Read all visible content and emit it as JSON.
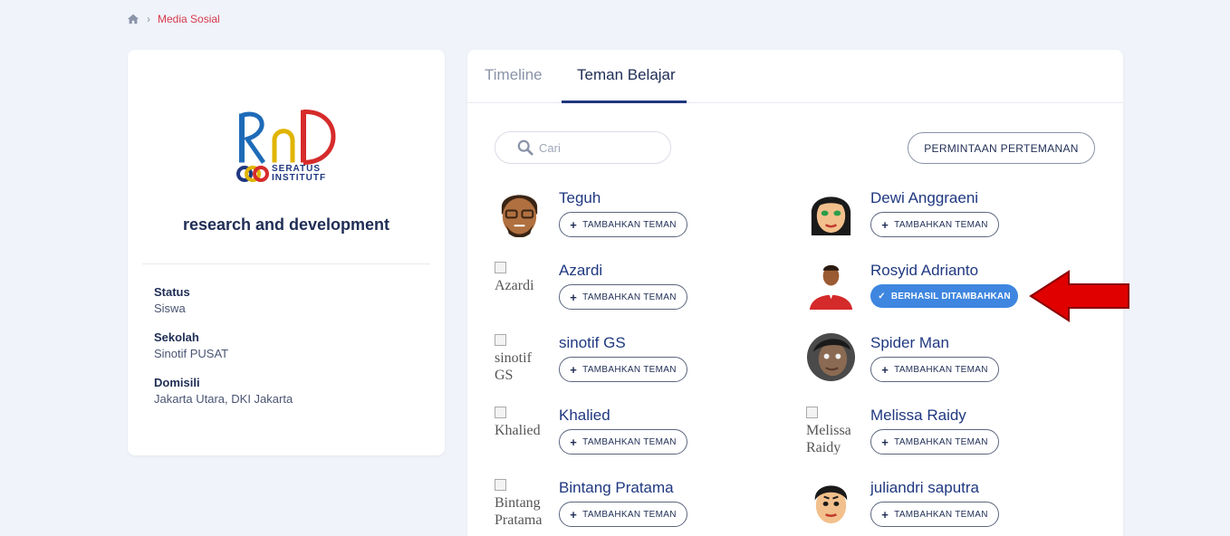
{
  "breadcrumb": {
    "current": "Media Sosial"
  },
  "profile": {
    "brand_mark": "RnD",
    "brand_sub": [
      "SERATUS",
      "INSTITUTF"
    ],
    "name": "research and development",
    "fields": [
      {
        "label": "Status",
        "value": "Siswa"
      },
      {
        "label": "Sekolah",
        "value": "Sinotif PUSAT"
      },
      {
        "label": "Domisili",
        "value": "Jakarta Utara, DKI Jakarta"
      }
    ]
  },
  "tabs": [
    {
      "label": "Timeline",
      "active": false
    },
    {
      "label": "Teman Belajar",
      "active": true
    }
  ],
  "search": {
    "placeholder": "Cari"
  },
  "friend_request_button": "PERMINTAAN PERTEMANAN",
  "add_label": "TAMBAHKAN TEMAN",
  "added_label": "BERHASIL DITAMBAHKAN",
  "friends_left": [
    {
      "name": "Teguh",
      "avatar": "man-cartoon"
    },
    {
      "name": "Azardi",
      "avatar": "broken",
      "alt": "Azardi"
    },
    {
      "name": "sinotif GS",
      "avatar": "broken",
      "alt": "sinotif GS"
    },
    {
      "name": "Khalied",
      "avatar": "broken",
      "alt": "Khalied"
    },
    {
      "name": "Bintang Pratama",
      "avatar": "broken",
      "alt": "Bintang Pratama"
    }
  ],
  "friends_right": [
    {
      "name": "Dewi Anggraeni",
      "avatar": "woman-cartoon"
    },
    {
      "name": "Rosyid Adrianto",
      "avatar": "photo-red-shirt",
      "added": true
    },
    {
      "name": "Spider Man",
      "avatar": "photo-face"
    },
    {
      "name": "Melissa Raidy",
      "avatar": "broken",
      "alt": "Melissa Raidy"
    },
    {
      "name": "juliandri saputra",
      "avatar": "man-cartoon-2"
    }
  ],
  "colors": {
    "accent": "#1f3880",
    "breadcrumb": "#d6394d",
    "success": "#3e86e0",
    "arrow": "#e00000"
  }
}
